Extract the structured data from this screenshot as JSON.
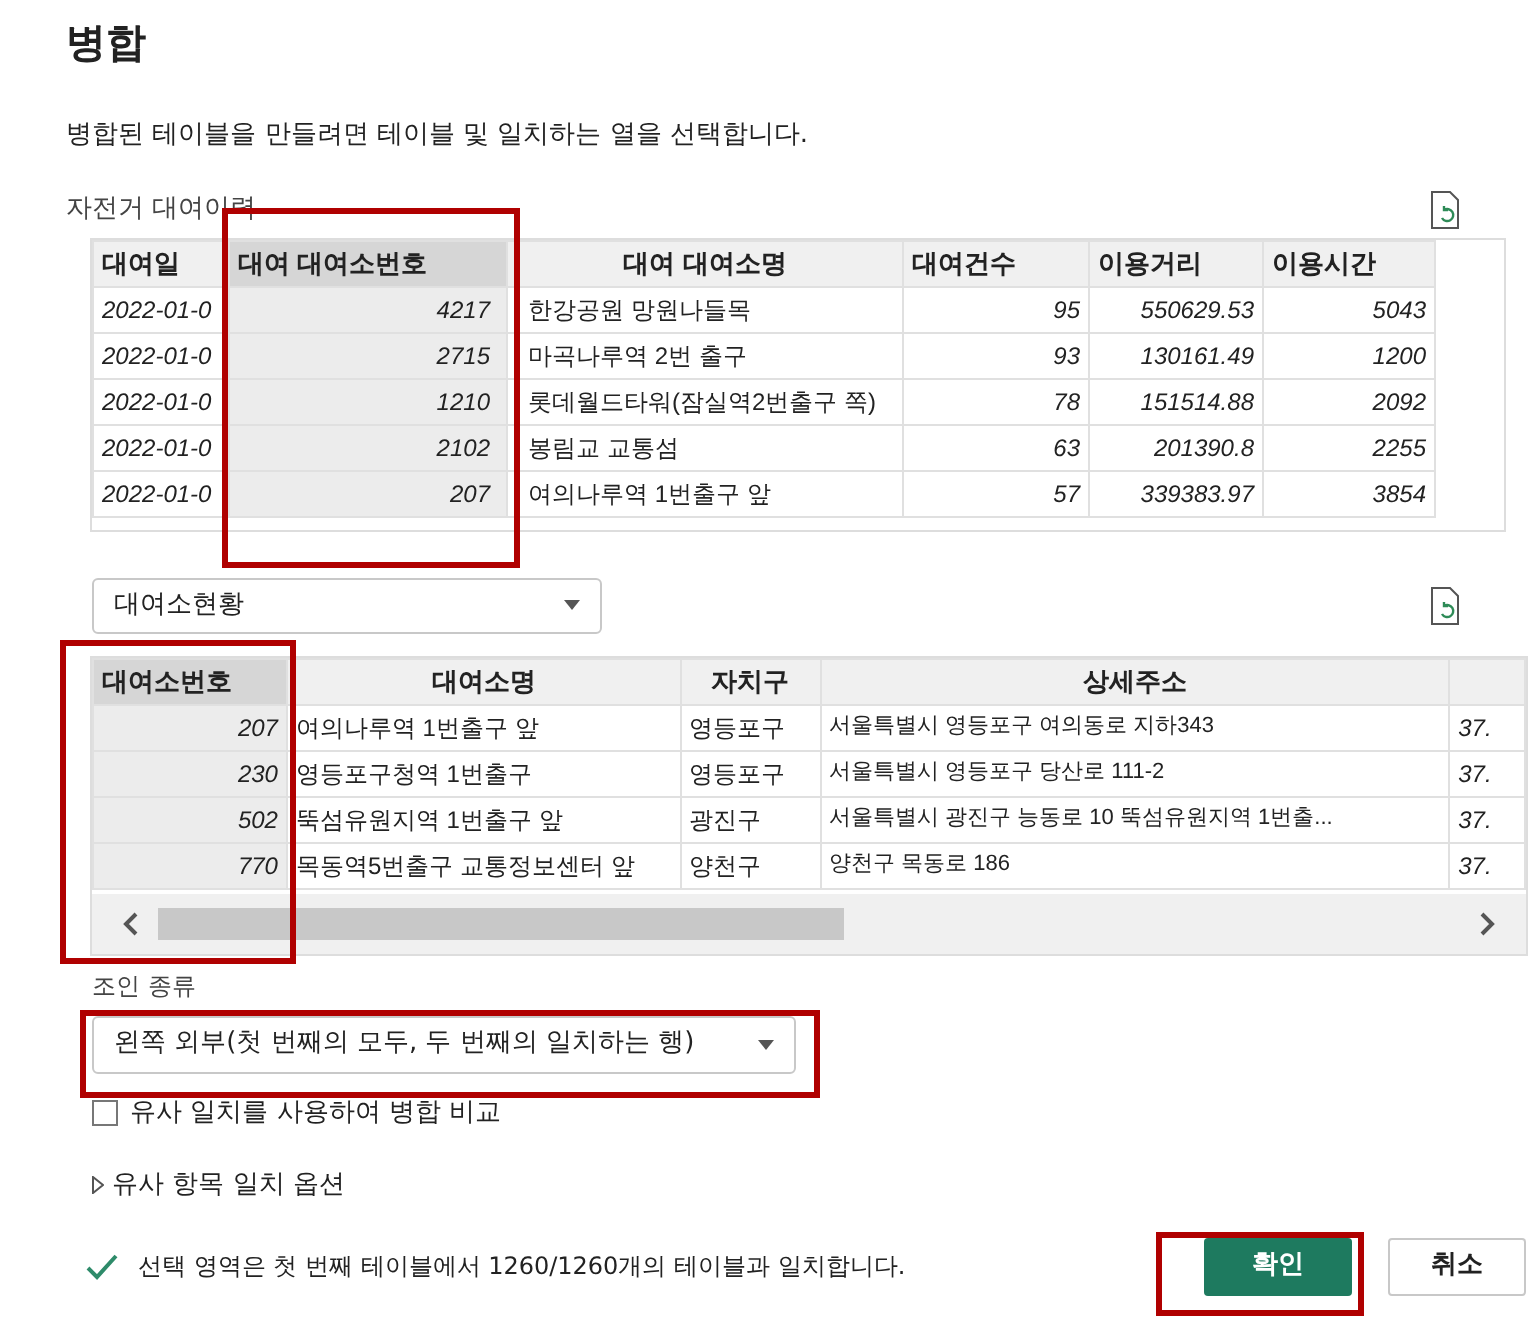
{
  "title": "병합",
  "description": "병합된 테이블을 만들려면 테이블 및 일치하는 열을 선택합니다.",
  "table1": {
    "name": "자전거 대여이력",
    "columns": [
      {
        "label": "대여일",
        "selected": false
      },
      {
        "label": "대여 대여소번호",
        "selected": true
      },
      {
        "label": "대여 대여소명",
        "selected": false
      },
      {
        "label": "대여건수",
        "selected": false
      },
      {
        "label": "이용거리",
        "selected": false
      },
      {
        "label": "이용시간",
        "selected": false
      }
    ],
    "rows": [
      [
        "2022-01-0",
        "4217",
        "한강공원 망원나들목",
        "95",
        "550629.53",
        "5043"
      ],
      [
        "2022-01-0",
        "2715",
        "마곡나루역 2번 출구",
        "93",
        "130161.49",
        "1200"
      ],
      [
        "2022-01-0",
        "1210",
        "롯데월드타워(잠실역2번출구 쪽)",
        "78",
        "151514.88",
        "2092"
      ],
      [
        "2022-01-0",
        "2102",
        "봉림교 교통섬",
        "63",
        "201390.8",
        "2255"
      ],
      [
        "2022-01-0",
        "207",
        "여의나루역 1번출구 앞",
        "57",
        "339383.97",
        "3854"
      ]
    ]
  },
  "table2_select": {
    "value": "대여소현황"
  },
  "table2": {
    "columns": [
      {
        "label": "대여소번호",
        "selected": true
      },
      {
        "label": "대여소명",
        "selected": false
      },
      {
        "label": "자치구",
        "selected": false
      },
      {
        "label": "상세주소",
        "selected": false
      },
      {
        "selected": false
      }
    ],
    "rows": [
      [
        "207",
        "여의나루역 1번출구 앞",
        "영등포구",
        "서울특별시 영등포구 여의동로 지하343",
        "37."
      ],
      [
        "230",
        "영등포구청역 1번출구",
        "영등포구",
        "서울특별시 영등포구 당산로 111-2",
        "37."
      ],
      [
        "502",
        "뚝섬유원지역 1번출구 앞",
        "광진구",
        "서울특별시 광진구 능동로 10 뚝섬유원지역 1번출...",
        "37."
      ],
      [
        "770",
        "목동역5번출구 교통정보센터 앞",
        "양천구",
        "양천구 목동로 186",
        "37."
      ]
    ]
  },
  "join_kind": {
    "label": "조인 종류",
    "value": "왼쪽 외부(첫 번째의 모두, 두 번째의 일치하는 행)"
  },
  "fuzzy": {
    "label": "유사 일치를 사용하여 병합 비교",
    "checked": false
  },
  "fuzzy_options": {
    "label": "유사 항목 일치 옵션",
    "expanded": false
  },
  "status": "선택 영역은 첫 번째 테이블에서 1260/1260개의 테이블과 일치합니다.",
  "buttons": [
    {
      "label": "확인",
      "kind": "primary"
    },
    {
      "label": "취소",
      "kind": "secondary"
    }
  ]
}
